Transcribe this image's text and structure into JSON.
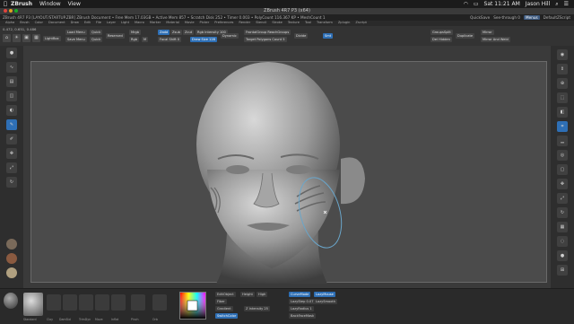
{
  "mac_menubar": {
    "app": "ZBrush",
    "items": [
      "Window",
      "View"
    ],
    "clock": "Sat 11:21 AM",
    "user": "Jason Hill"
  },
  "window_title": "ZBrush 4R7 P3 (x64)",
  "status_bar": {
    "left": "ZBrush 4R7 P3  [LAYOUT/STARTUP.ZBR]   ZBrush Document   • Free Mem 17.03GB • Active Mem 857 • Scratch Disk 252 • Timer 0.003 • PolyCount 116.367 KP • MeshCount 1",
    "quicksave": "QuickSave",
    "see_through": "See-through  0",
    "menus": "Menus",
    "script": "DefaultZScript"
  },
  "menus": [
    "Alpha",
    "Brush",
    "Color",
    "Document",
    "Draw",
    "Edit",
    "File",
    "Layer",
    "Light",
    "Macro",
    "Marker",
    "Material",
    "Movie",
    "Picker",
    "Preferences",
    "Render",
    "Stencil",
    "Stroke",
    "Texture",
    "Tool",
    "Transform",
    "Zplugin",
    "Zscript"
  ],
  "toolbar": {
    "coords": "0.472, 0.651, 0.486",
    "lightbox": "LightBox",
    "load_menu": "Load Menu",
    "save_menu": "Save Menu",
    "quick": "Quick",
    "quick2": "Quick",
    "reserved": "Reserved",
    "mrgb": "Mrgb",
    "rgb": "Rgb",
    "m": "M",
    "zadd": "Zadd",
    "zsub": "Zsub",
    "zcut": "Zcut",
    "focal_shift": "Focal Shift 0",
    "draw_size": "Draw Size 128",
    "rgb_intensity": "Rgb Intensity 100",
    "z_intensity": "Z Intensity 25",
    "dynamic": "Dynamic",
    "frontal": "FrontalGroup  ReachGroups",
    "target_polygons": "Target Polygons Count 5",
    "divide": "Divide",
    "smt": "Smt",
    "groups_split": "GroupsSplit",
    "del_hidden": "Del Hidden",
    "duplicate": "Duplicate",
    "mirror": "Mirror",
    "mirror_weld": "Mirror And Weld"
  },
  "left_shelf": [
    "Edit",
    "Draw",
    "Move",
    "Scale",
    "Rotate",
    "Brush",
    "Stroke",
    "Alpha"
  ],
  "right_shelf": [
    "BPR",
    "SPix 3",
    "Scroll",
    "Zoom",
    "Actual",
    "AAHalf",
    "Persp",
    "Floor",
    "Local",
    "L.Sym",
    "Frame",
    "Move",
    "Scale",
    "Rotate",
    "PolyF",
    "Transp",
    "Solo",
    "Xpose"
  ],
  "bottom": {
    "materials": [
      "Standard",
      "Clay",
      "DamStd",
      "TrimDyn",
      "Move",
      "Inflat",
      "Pinch",
      "Orb"
    ],
    "edit_object": "EditObject",
    "height": "Height",
    "high": "High",
    "fiber": "Fiber",
    "gradient": "Gradient",
    "switch_color": "SwitchColor",
    "alternate": "Alternate",
    "z_intensity": "Z Intensity 25",
    "curve_mode": "CurveMode",
    "lazy_mouse": "LazyMouse",
    "lazy_step": "LazyStep 0.07",
    "lazy_smooth": "LazySmooth",
    "lazy_radius": "LazyRadius 1",
    "back_face": "BackFaceMask",
    "solo": "Solo"
  },
  "colors": {
    "accent": "#2e6fb5",
    "canvas_bg": "#4b4b4b",
    "ui_dark": "#2b2b2b",
    "highlight": "#e8a020"
  }
}
